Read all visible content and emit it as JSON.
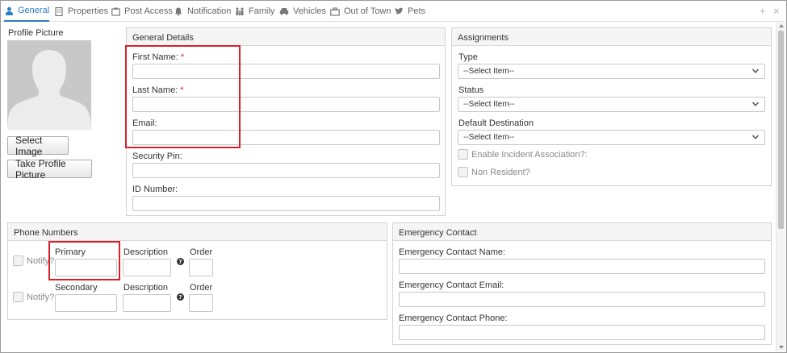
{
  "tabs": [
    {
      "label": "General",
      "icon": "user-icon",
      "active": true
    },
    {
      "label": "Properties",
      "icon": "building-icon",
      "active": false
    },
    {
      "label": "Post Access",
      "icon": "post-access-icon",
      "active": false
    },
    {
      "label": "Notification",
      "icon": "bell-icon",
      "active": false
    },
    {
      "label": "Family",
      "icon": "family-icon",
      "active": false
    },
    {
      "label": "Vehicles",
      "icon": "car-icon",
      "active": false
    },
    {
      "label": "Out of Town",
      "icon": "suitcase-icon",
      "active": false
    },
    {
      "label": "Pets",
      "icon": "twitter-bird-icon",
      "active": false
    }
  ],
  "tab_controls": {
    "add": "+",
    "close": "×"
  },
  "profile": {
    "label": "Profile Picture",
    "select_image": "Select Image",
    "take_picture": "Take Profile Picture"
  },
  "general_details": {
    "title": "General Details",
    "first_name": {
      "label": "First Name:",
      "required": "*",
      "value": ""
    },
    "last_name": {
      "label": "Last Name:",
      "required": "*",
      "value": ""
    },
    "email": {
      "label": "Email:",
      "value": ""
    },
    "security_pin": {
      "label": "Security Pin:",
      "value": ""
    },
    "id_number": {
      "label": "ID Number:",
      "value": ""
    }
  },
  "assignments": {
    "title": "Assignments",
    "type": {
      "label": "Type",
      "selected": "--Select Item--"
    },
    "status": {
      "label": "Status",
      "selected": "--Select Item--"
    },
    "default_destination": {
      "label": "Default Destination",
      "selected": "--Select Item--"
    },
    "enable_incident": "Enable Incident Association?:",
    "non_resident": "Non Resident?"
  },
  "phone_numbers": {
    "title": "Phone Numbers",
    "rows": [
      {
        "notify": "Notify?",
        "number_label": "Primary",
        "description_label": "Description",
        "order_label": "Order"
      },
      {
        "notify": "Notify?",
        "number_label": "Secondary",
        "description_label": "Description",
        "order_label": "Order"
      }
    ],
    "help_glyph": "?"
  },
  "emergency_contact": {
    "title": "Emergency Contact",
    "name_label": "Emergency Contact Name:",
    "email_label": "Emergency Contact Email:",
    "phone_label": "Emergency Contact Phone:"
  },
  "colors": {
    "accent": "#2a7ec4",
    "required": "#dd2222",
    "highlight": "#d9202a"
  }
}
